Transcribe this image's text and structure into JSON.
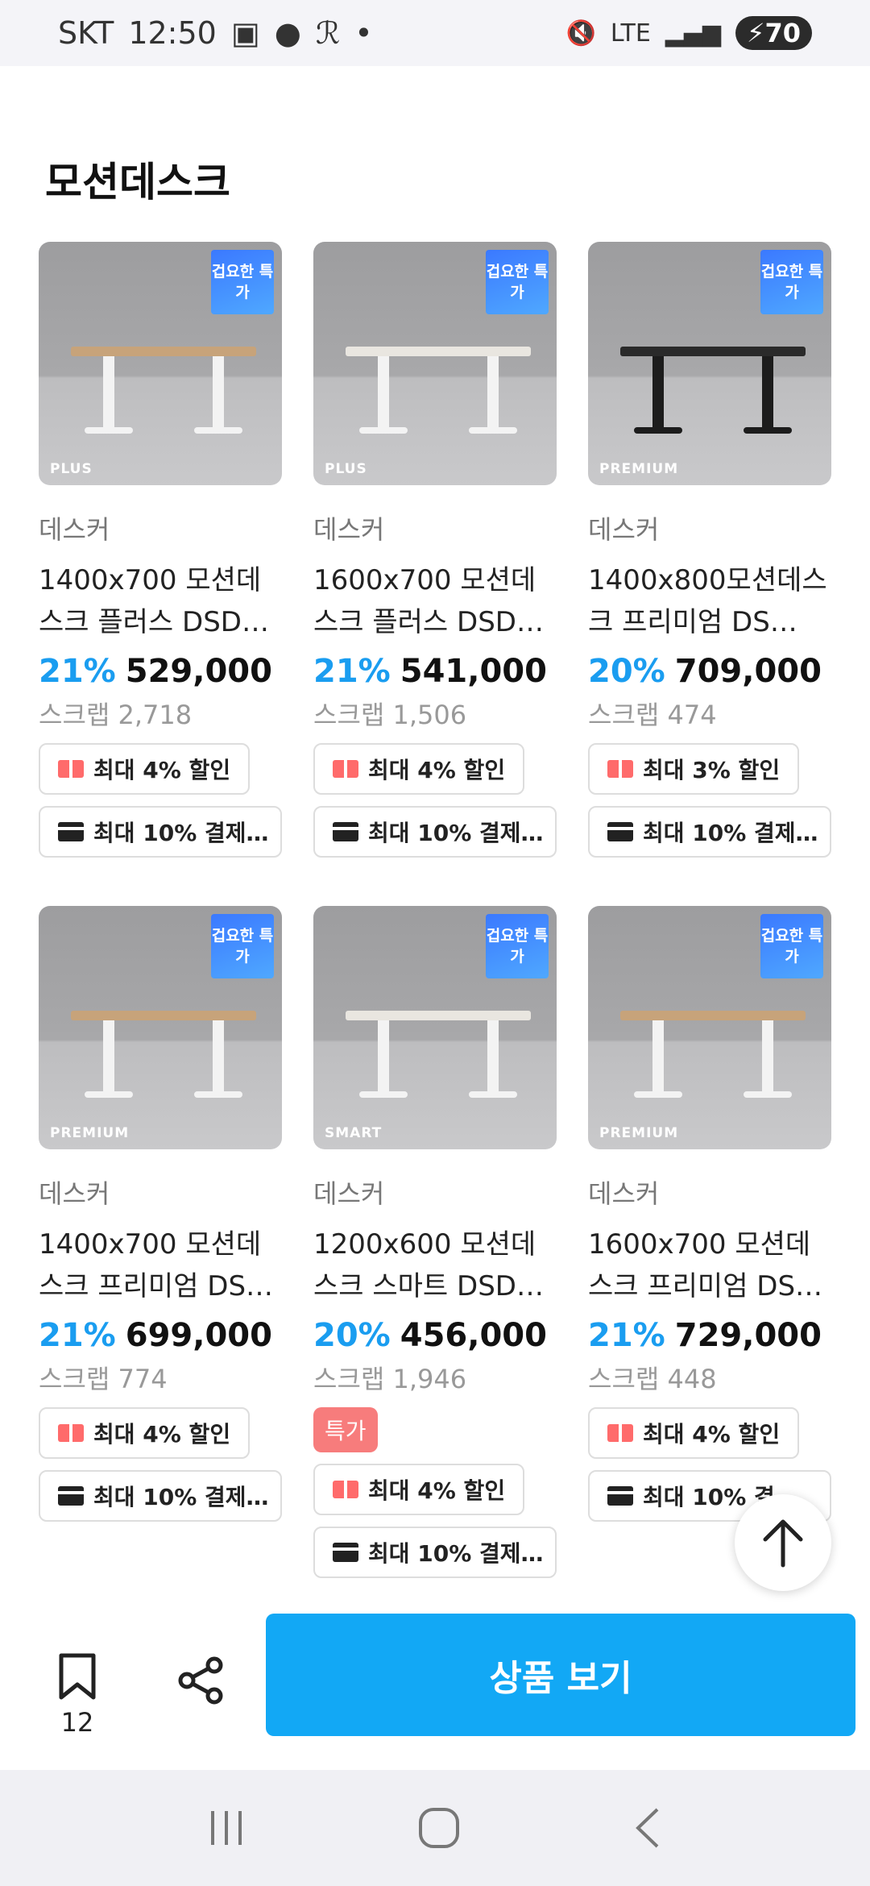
{
  "status_bar": {
    "carrier": "SKT",
    "time": "12:50",
    "battery": "70",
    "network": "LTE"
  },
  "section_title": "모션데스크",
  "badge_text": "겁요한 특가",
  "products": [
    {
      "tier": "PLUS",
      "brand": "데스커",
      "name": "1400x700 모션데스크 플러스 DSD…",
      "discount": "21%",
      "price": "529,000",
      "scrap": "스크랩 2,718",
      "coupon": "최대 4% 할인",
      "payment": "최대 10% 결제…",
      "special": "",
      "desk_top": "#c7a37a",
      "desk_leg": "#f3f3f3"
    },
    {
      "tier": "PLUS",
      "brand": "데스커",
      "name": "1600x700 모션데스크 플러스 DSD…",
      "discount": "21%",
      "price": "541,000",
      "scrap": "스크랩 1,506",
      "coupon": "최대 4% 할인",
      "payment": "최대 10% 결제…",
      "special": "",
      "desk_top": "#e9e6e0",
      "desk_leg": "#f3f3f3"
    },
    {
      "tier": "PREMIUM",
      "brand": "데스커",
      "name": "1400x800모션데스크 프리미엄 DS…",
      "discount": "20%",
      "price": "709,000",
      "scrap": "스크랩 474",
      "coupon": "최대 3% 할인",
      "payment": "최대 10% 결제…",
      "special": "",
      "desk_top": "#2a2a2a",
      "desk_leg": "#1c1c1c"
    },
    {
      "tier": "PREMIUM",
      "brand": "데스커",
      "name": "1400x700 모션데스크 프리미엄 DS…",
      "discount": "21%",
      "price": "699,000",
      "scrap": "스크랩 774",
      "coupon": "최대 4% 할인",
      "payment": "최대 10% 결제…",
      "special": "",
      "desk_top": "#c7a37a",
      "desk_leg": "#f3f3f3"
    },
    {
      "tier": "SMART",
      "brand": "데스커",
      "name": "1200x600 모션데스크 스마트 DSD…",
      "discount": "20%",
      "price": "456,000",
      "scrap": "스크랩 1,946",
      "coupon": "최대 4% 할인",
      "payment": "최대 10% 결제…",
      "special": "특가",
      "desk_top": "#e9e6e0",
      "desk_leg": "#f3f3f3"
    },
    {
      "tier": "PREMIUM",
      "brand": "데스커",
      "name": "1600x700 모션데스크 프리미엄 DS…",
      "discount": "21%",
      "price": "729,000",
      "scrap": "스크랩 448",
      "coupon": "최대 4% 할인",
      "payment": "최대 10% 결…",
      "special": "",
      "desk_top": "#c7a37a",
      "desk_leg": "#f3f3f3"
    }
  ],
  "bottom_bar": {
    "bookmark_count": "12",
    "cta_label": "상품 보기"
  },
  "colors": {
    "accent": "#12a8f5",
    "discount": "#1a9df0",
    "special": "#f77c7c"
  }
}
